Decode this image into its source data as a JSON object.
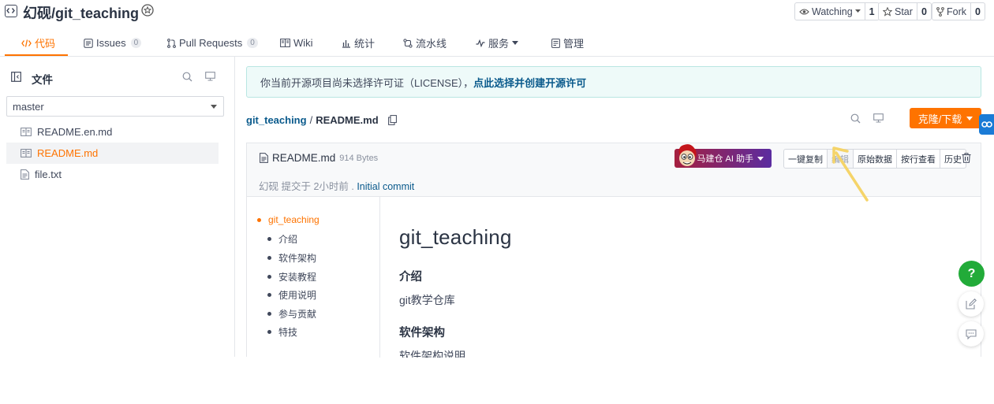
{
  "header": {
    "title": "幻砚/git_teaching",
    "watching": {
      "label": "Watching",
      "count": "1"
    },
    "star": {
      "label": "Star",
      "count": "0"
    },
    "fork": {
      "label": "Fork",
      "count": "0"
    }
  },
  "tabs": [
    {
      "label": "代码",
      "icon": "code-icon"
    },
    {
      "label": "Issues",
      "count": "0",
      "icon": "issues-icon"
    },
    {
      "label": "Pull Requests",
      "count": "0",
      "icon": "pull-request-icon"
    },
    {
      "label": "Wiki",
      "icon": "book-icon"
    },
    {
      "label": "统计",
      "icon": "bar-chart-icon"
    },
    {
      "label": "流水线",
      "icon": "pipeline-icon"
    },
    {
      "label": "服务",
      "icon": "pulse-icon"
    },
    {
      "label": "管理",
      "icon": "manage-icon"
    }
  ],
  "sidebar": {
    "title": "文件",
    "branch": "master",
    "files": [
      {
        "name": "README.en.md",
        "icon": "markdown-file-icon"
      },
      {
        "name": "README.md",
        "icon": "markdown-file-icon"
      },
      {
        "name": "file.txt",
        "icon": "text-file-icon"
      }
    ]
  },
  "license": {
    "text": "你当前开源项目尚未选择许可证（LICENSE），",
    "link": "点此选择并创建开源许可"
  },
  "breadcrumb": {
    "repo": "git_teaching",
    "sep": "/",
    "file": "README.md"
  },
  "clone_label": "克隆/下载",
  "file_view": {
    "name": "README.md",
    "size": "914 Bytes",
    "commit_prefix": "幻砚 提交于 2小时前 . ",
    "commit_link": "Initial commit",
    "ai_label": "马建仓 AI 助手",
    "buttons": [
      "一键复制",
      "编辑",
      "原始数据",
      "按行查看",
      "历史"
    ]
  },
  "toc": [
    "git_teaching",
    "介绍",
    "软件架构",
    "安装教程",
    "使用说明",
    "参与贡献",
    "特技"
  ],
  "readme": {
    "h1": "git_teaching",
    "h2_intro": "介绍",
    "p_intro": "git教学仓库",
    "h2_arch": "软件架构",
    "p_arch": "软件架构说明"
  },
  "help_label": "?",
  "colors": {
    "accent": "#fe7300",
    "link": "#0a5a8c",
    "help": "#22ab39"
  }
}
